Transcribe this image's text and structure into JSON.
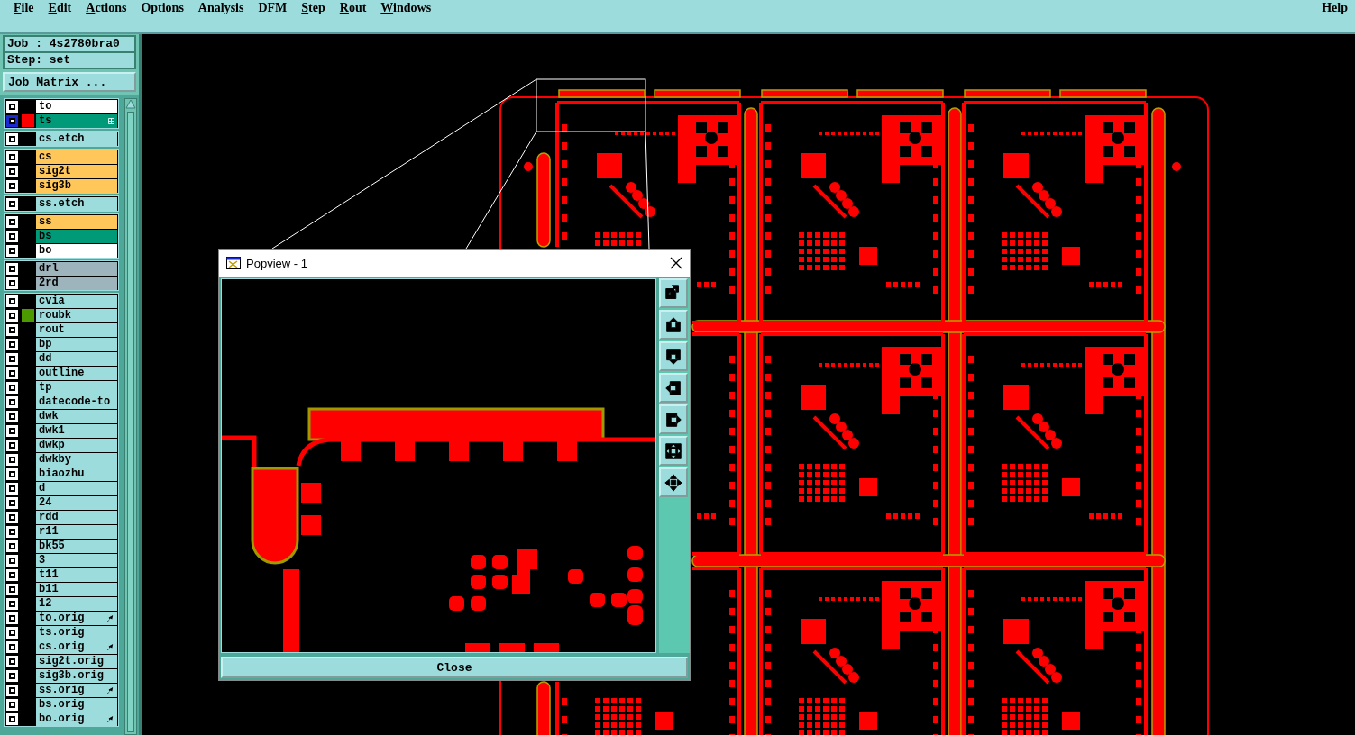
{
  "menu": [
    {
      "label": "File",
      "underlined": true
    },
    {
      "label": "Edit",
      "underlined": true
    },
    {
      "label": "Actions",
      "underlined": true
    },
    {
      "label": "Options",
      "underlined": false
    },
    {
      "label": "Analysis",
      "underlined": false
    },
    {
      "label": "DFM",
      "underlined": false
    },
    {
      "label": "Step",
      "underlined": true
    },
    {
      "label": "Rout",
      "underlined": true
    },
    {
      "label": "Windows",
      "underlined": true
    }
  ],
  "help": {
    "label": "Help",
    "underlined": false
  },
  "job": "Job : 4s2780bra0",
  "step": "Step: set",
  "job_matrix_button": "Job Matrix ...",
  "layer_groups": [
    {
      "layers": [
        {
          "name": "to",
          "color": "#ffffff",
          "kind": "plain",
          "selected": false
        },
        {
          "name": "ts",
          "color": "#009a78",
          "kind": "grid",
          "selected": true,
          "swatch": {
            "color": "#ff0000"
          }
        }
      ]
    },
    {
      "layers": [
        {
          "name": "cs.etch",
          "color": "#9ddcdc",
          "kind": "plain",
          "selected": false
        }
      ]
    },
    {
      "layers": [
        {
          "name": "cs",
          "color": "#ffc759",
          "kind": "plain",
          "selected": false
        },
        {
          "name": "sig2t",
          "color": "#ffc759",
          "kind": "plain",
          "selected": false
        },
        {
          "name": "sig3b",
          "color": "#ffc759",
          "kind": "plain",
          "selected": false
        }
      ]
    },
    {
      "layers": [
        {
          "name": "ss.etch",
          "color": "#9ddcdc",
          "kind": "plain",
          "selected": false
        }
      ]
    },
    {
      "layers": [
        {
          "name": "ss",
          "color": "#ffc759",
          "kind": "plain",
          "selected": false
        },
        {
          "name": "bs",
          "color": "#009a78",
          "kind": "plain",
          "selected": false
        },
        {
          "name": "bo",
          "color": "#ffffff",
          "kind": "plain",
          "selected": false
        }
      ]
    },
    {
      "layers": [
        {
          "name": "drl",
          "color": "#9eb4bc",
          "kind": "plain",
          "selected": false
        },
        {
          "name": "2rd",
          "color": "#9eb4bc",
          "kind": "plain",
          "selected": false
        }
      ]
    },
    {
      "layers": [
        {
          "name": "cvia",
          "color": "#9ddcdc",
          "kind": "plain",
          "selected": false
        },
        {
          "name": "roubk",
          "color": "#9ddcdc",
          "kind": "plain",
          "selected": false,
          "swatch": {
            "color": "#4a9a00"
          }
        },
        {
          "name": "rout",
          "color": "#9ddcdc",
          "kind": "plain",
          "selected": false
        },
        {
          "name": "bp",
          "color": "#9ddcdc",
          "kind": "plain",
          "selected": false
        },
        {
          "name": "dd",
          "color": "#9ddcdc",
          "kind": "plain",
          "selected": false
        },
        {
          "name": "outline",
          "color": "#9ddcdc",
          "kind": "plain",
          "selected": false
        },
        {
          "name": "tp",
          "color": "#9ddcdc",
          "kind": "plain",
          "selected": false
        },
        {
          "name": "datecode-to",
          "color": "#9ddcdc",
          "kind": "plain",
          "selected": false
        },
        {
          "name": "dwk",
          "color": "#9ddcdc",
          "kind": "plain",
          "selected": false
        },
        {
          "name": "dwk1",
          "color": "#9ddcdc",
          "kind": "plain",
          "selected": false
        },
        {
          "name": "dwkp",
          "color": "#9ddcdc",
          "kind": "plain",
          "selected": false
        },
        {
          "name": "dwkby",
          "color": "#9ddcdc",
          "kind": "plain",
          "selected": false
        },
        {
          "name": "biaozhu",
          "color": "#9ddcdc",
          "kind": "plain",
          "selected": false
        },
        {
          "name": "d",
          "color": "#9ddcdc",
          "kind": "plain",
          "selected": false
        },
        {
          "name": "24",
          "color": "#9ddcdc",
          "kind": "plain",
          "selected": false
        },
        {
          "name": "rdd",
          "color": "#9ddcdc",
          "kind": "plain",
          "selected": false
        },
        {
          "name": "r11",
          "color": "#9ddcdc",
          "kind": "plain",
          "selected": false
        },
        {
          "name": "bk55",
          "color": "#9ddcdc",
          "kind": "plain",
          "selected": false
        },
        {
          "name": "3",
          "color": "#9ddcdc",
          "kind": "plain",
          "selected": false
        },
        {
          "name": "t11",
          "color": "#9ddcdc",
          "kind": "plain",
          "selected": false
        },
        {
          "name": "b11",
          "color": "#9ddcdc",
          "kind": "plain",
          "selected": false
        },
        {
          "name": "12",
          "color": "#9ddcdc",
          "kind": "plain",
          "selected": false
        },
        {
          "name": "to.orig",
          "color": "#9ddcdc",
          "kind": "pointer",
          "selected": false
        },
        {
          "name": "ts.orig",
          "color": "#9ddcdc",
          "kind": "plain",
          "selected": false
        },
        {
          "name": "cs.orig",
          "color": "#9ddcdc",
          "kind": "pointer",
          "selected": false
        },
        {
          "name": "sig2t.orig",
          "color": "#9ddcdc",
          "kind": "plain",
          "selected": false
        },
        {
          "name": "sig3b.orig",
          "color": "#9ddcdc",
          "kind": "plain",
          "selected": false
        },
        {
          "name": "ss.orig",
          "color": "#9ddcdc",
          "kind": "pointer",
          "selected": false
        },
        {
          "name": "bs.orig",
          "color": "#9ddcdc",
          "kind": "plain",
          "selected": false
        },
        {
          "name": "bo.orig",
          "color": "#9ddcdc",
          "kind": "pointer",
          "selected": false
        }
      ]
    }
  ],
  "popview": {
    "title": "Popview - 1",
    "close_button": "Close"
  }
}
